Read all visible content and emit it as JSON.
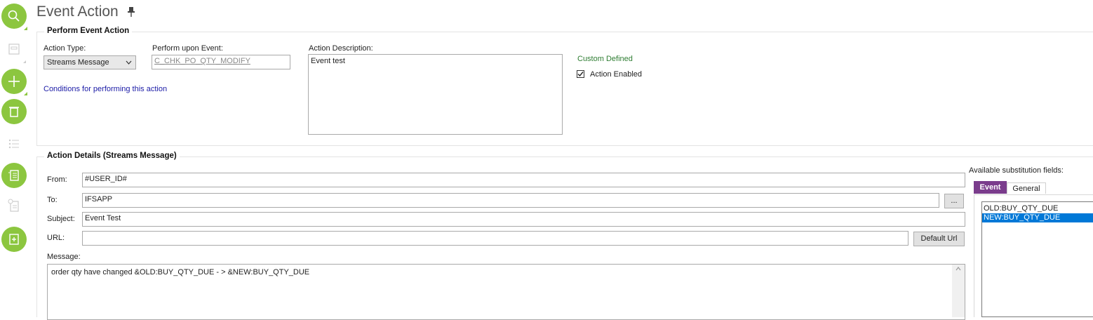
{
  "page": {
    "title": "Event Action"
  },
  "perform_section": {
    "title": "Perform Event Action",
    "action_type_label": "Action Type:",
    "action_type_value": "Streams Message",
    "perform_upon_label": "Perform upon Event:",
    "perform_upon_value": "C_CHK_PO_QTY_MODIFY",
    "description_label": "Action Description:",
    "description_value": "Event test",
    "conditions_link": "Conditions for performing this action",
    "custom_defined": "Custom Defined",
    "action_enabled_label": "Action Enabled",
    "action_enabled": true
  },
  "details_section": {
    "title": "Action Details (Streams Message)",
    "from_label": "From:",
    "from_value": "#USER_ID#",
    "to_label": "To:",
    "to_value": "IFSAPP",
    "to_browse_label": "...",
    "subject_label": "Subject:",
    "subject_value": "Event Test",
    "url_label": "URL:",
    "url_value": "",
    "default_url_label": "Default Url",
    "message_label": "Message:",
    "message_value": "order qty have changed &OLD:BUY_QTY_DUE - > &NEW:BUY_QTY_DUE"
  },
  "substitution": {
    "title": "Available substitution fields:",
    "tabs": [
      "Event",
      "General"
    ],
    "active_tab": "Event",
    "fields": [
      "OLD:BUY_QTY_DUE",
      "NEW:BUY_QTY_DUE"
    ],
    "selected_index": 1
  },
  "toolbar": {
    "icons": [
      "search-icon",
      "details-icon",
      "add-icon",
      "delete-icon",
      "list-icon",
      "checklist-icon",
      "document-info-icon",
      "new-document-icon"
    ]
  },
  "colors": {
    "accent_green": "#8cc63f",
    "tab_purple": "#7a3c8c",
    "link_blue": "#1a1aa6",
    "selection_blue": "#0078d7"
  }
}
